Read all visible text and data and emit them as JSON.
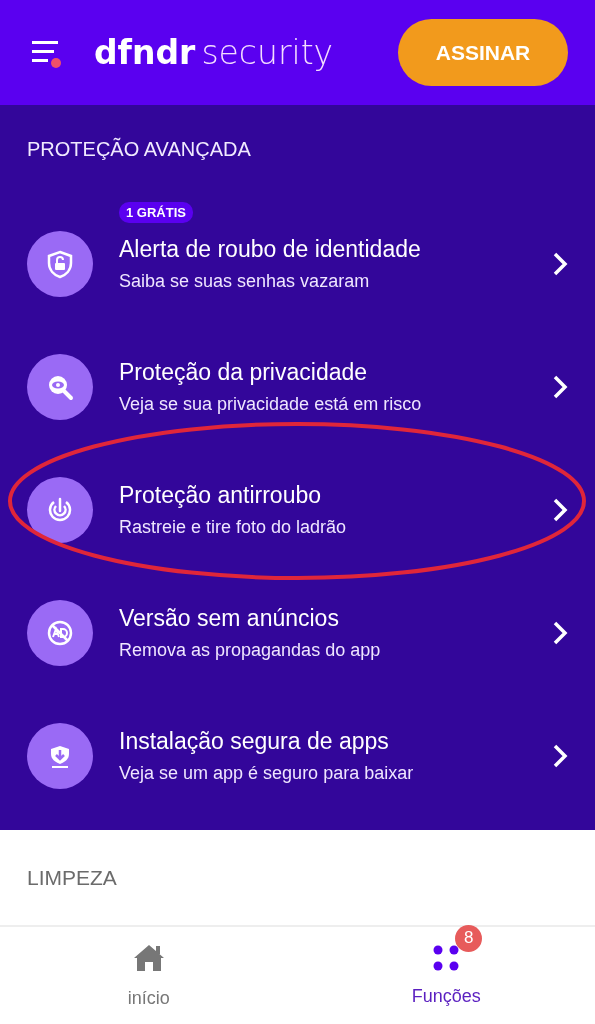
{
  "header": {
    "logo_bold": "dfndr",
    "logo_light": "security",
    "menu_notification": true,
    "subscribe_button": "ASSINAR"
  },
  "section": {
    "title": "PROTEÇÃO AVANÇADA",
    "items": [
      {
        "badge": "1 GRÁTIS",
        "title": "Alerta de roubo de identidade",
        "subtitle": "Saiba se suas senhas vazaram",
        "highlighted": false
      },
      {
        "title": "Proteção da privacidade",
        "subtitle": "Veja se sua privacidade está em risco",
        "highlighted": false
      },
      {
        "title": "Proteção antirroubo",
        "subtitle": "Rastreie e tire foto do ladrão",
        "highlighted": true
      },
      {
        "title": "Versão sem anúncios",
        "subtitle": "Remova as propagandas do app",
        "highlighted": false
      },
      {
        "title": "Instalação segura de apps",
        "subtitle": "Veja se um app é seguro para baixar",
        "highlighted": false
      }
    ]
  },
  "next_section": {
    "title": "LIMPEZA"
  },
  "bottom_nav": [
    {
      "label": "início",
      "selected": false
    },
    {
      "label": "Funções",
      "selected": true,
      "badge": "8"
    }
  ]
}
